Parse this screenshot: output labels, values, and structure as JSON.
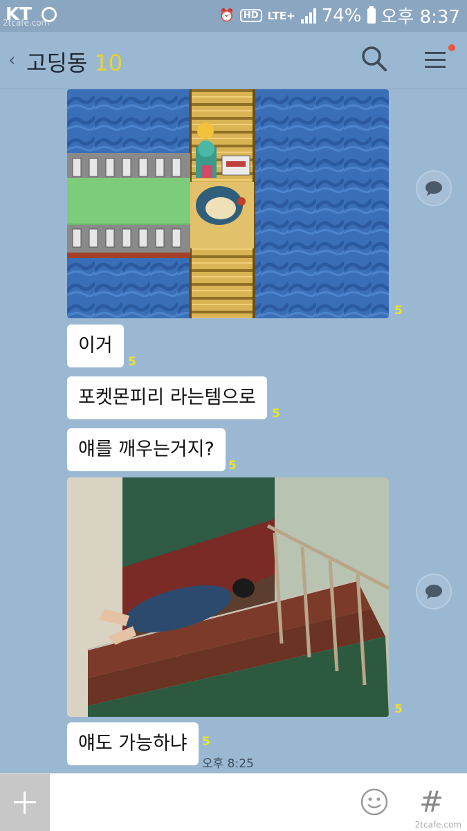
{
  "status_bar": {
    "carrier": "KT",
    "watermark": "2tcafe.com",
    "hd": "HD",
    "network": "LTE+",
    "battery": "74%",
    "time": "오후 8:37"
  },
  "header": {
    "back_icon": "back-chevron",
    "title": "고딩동",
    "member_count": "10",
    "search_icon": "search-icon",
    "menu_icon": "hamburger-menu-icon",
    "notification_dot_color": "#f0533b"
  },
  "messages": [
    {
      "type": "image",
      "description_icon": "pokemon-game-screenshot",
      "unread": "5"
    },
    {
      "type": "text",
      "text": "이거",
      "unread": "5"
    },
    {
      "type": "text",
      "text": "포켓몬피리 라는템으로",
      "unread": "5"
    },
    {
      "type": "text",
      "text": "얘를 깨우는거지?",
      "unread": "5"
    },
    {
      "type": "image",
      "description_icon": "staircase-photo",
      "unread": "5"
    },
    {
      "type": "text",
      "text": "얘도 가능하냐",
      "unread": "5",
      "time": "오후 8:25"
    }
  ],
  "input_bar": {
    "plus_icon": "plus-icon",
    "emoji_icon": "emoji-icon",
    "hash_icon": "#",
    "watermark": "2tcafe.com"
  },
  "colors": {
    "chat_bg": "#9bb8d3",
    "unread_count": "#ede22a",
    "bubble": "#ffffff"
  }
}
